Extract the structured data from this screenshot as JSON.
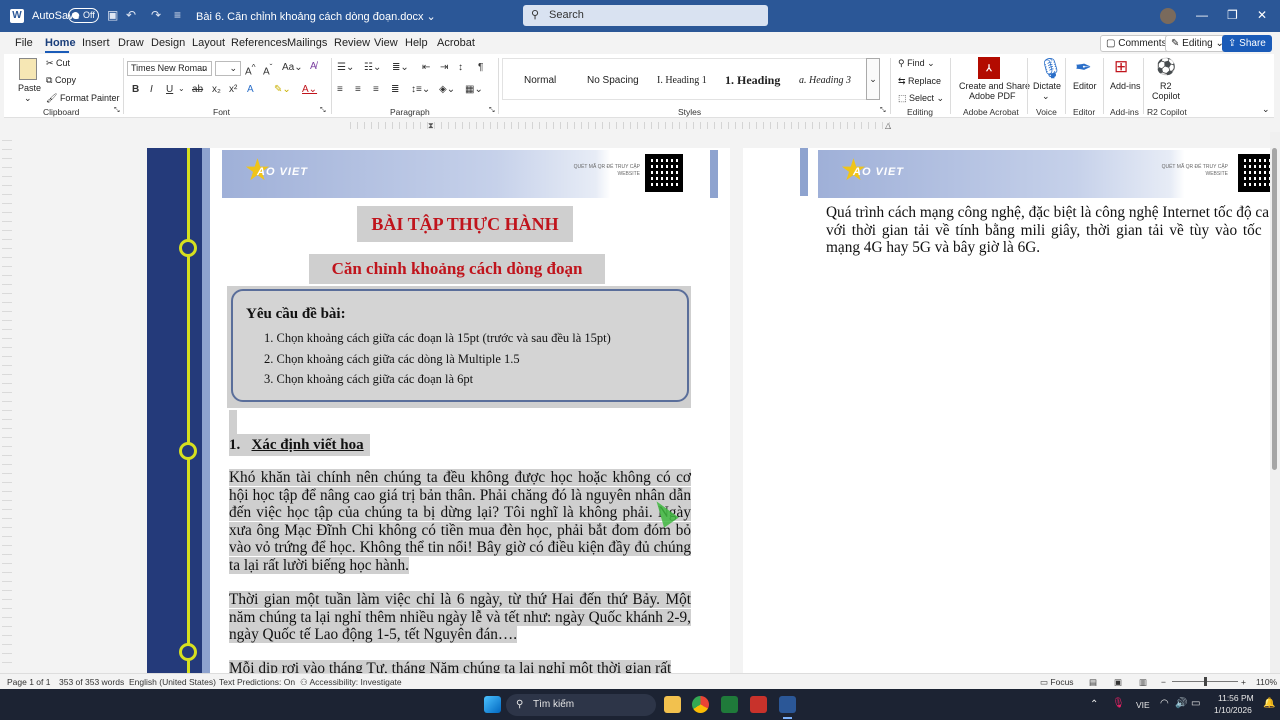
{
  "titlebar": {
    "autosave_label": "AutoSave",
    "autosave_state": "Off",
    "document_name": "Bài 6. Căn chỉnh khoảng cách dòng đoạn.docx",
    "search_placeholder": "Search"
  },
  "menu": {
    "tabs": [
      "File",
      "Home",
      "Insert",
      "Draw",
      "Design",
      "Layout",
      "References",
      "Mailings",
      "Review",
      "View",
      "Help",
      "Acrobat"
    ],
    "active_tab": "Home",
    "comments": "Comments",
    "editing": "Editing",
    "share": "Share"
  },
  "ribbon": {
    "clipboard": {
      "paste": "Paste",
      "cut": "Cut",
      "copy": "Copy",
      "format_painter": "Format Painter",
      "label": "Clipboard"
    },
    "font": {
      "name": "Times New Roman",
      "size": "",
      "label": "Font"
    },
    "paragraph": {
      "label": "Paragraph"
    },
    "styles": {
      "items": [
        "Normal",
        "No Spacing",
        "I.  Heading 1",
        "1.  Heading",
        "a.  Heading 3"
      ],
      "label": "Styles"
    },
    "editing": {
      "find": "Find",
      "replace": "Replace",
      "select": "Select",
      "label": "Editing"
    },
    "acrobat": {
      "create": "Create and Share",
      "create2": "Adobe PDF",
      "label": "Adobe Acrobat"
    },
    "voice": {
      "dictate": "Dictate",
      "label": "Voice"
    },
    "editor": {
      "editor": "Editor",
      "label": "Editor"
    },
    "addins": {
      "addins": "Add-ins",
      "label": "Add-ins"
    },
    "copilot": {
      "name": "R2",
      "name2": "Copilot",
      "label": "R2 Copilot"
    }
  },
  "page1": {
    "logo": "AO VIET",
    "qr_text": "QUÉT MÃ QR ĐỂ TRUY CẬP WEBSITE",
    "title": "BÀI TẬP THỰC HÀNH",
    "subtitle": "Căn chỉnh khoảng cách dòng đoạn",
    "requirements_title": "Yêu cầu đề bài:",
    "requirements": [
      "1.   Chọn khoảng cách giữa các đoạn là 15pt (trước và sau đều là 15pt)",
      "2.   Chọn khoảng cách giữa các dòng là Multiple 1.5",
      "3.   Chọn khoảng cách giữa các đoạn là 6pt"
    ],
    "section_number": "1.",
    "section_title": "Xác định viết hoa",
    "paragraphs": [
      "Khó khăn tài chính nên chúng ta đều không được học hoặc không có cơ hội học tập để nâng cao giá trị bản thân. Phải chăng đó là nguyên nhân dẫn đến việc học tập của chúng ta bị dừng lại? Tôi nghĩ là không phải. Ngày xưa ông Mạc Đĩnh Chi không có tiền mua đèn học, phải bắt đom đóm bỏ vào vỏ trứng để học. Không thể tin nổi! Bây giờ có điều kiện đầy đủ chúng ta lại rất lười biếng học hành.",
      "Thời gian một tuần làm việc chỉ là 6 ngày, từ thứ Hai đến thứ Bảy. Một năm chúng ta lại nghỉ thêm nhiều ngày lễ và tết như: ngày Quốc khánh 2-9, ngày Quốc tế Lao động 1-5, tết Nguyên đán….",
      "Mỗi dịp rơi vào tháng Tư, tháng Năm chúng ta lại nghỉ một thời gian rất"
    ]
  },
  "page2": {
    "logo": "AO VIET",
    "text_lines": [
      "Quá trình cách mạng công nghệ, đặc biệt là công nghệ Internet tốc độ ca",
      "với thời gian tải về tính bằng mili giây, thời gian tải về tùy vào tốc",
      "mạng 4G hay 5G và bây giờ là 6G."
    ]
  },
  "statusbar": {
    "page": "Page 1 of 1",
    "words": "353 of 353 words",
    "language": "English (United States)",
    "predictions": "Text Predictions: On",
    "accessibility": "Accessibility: Investigate",
    "focus": "Focus",
    "zoom": "110%"
  },
  "taskbar": {
    "search": "Tìm kiếm",
    "lang": "VIE",
    "time": "11:56 PM",
    "date": "1/10/2026"
  }
}
